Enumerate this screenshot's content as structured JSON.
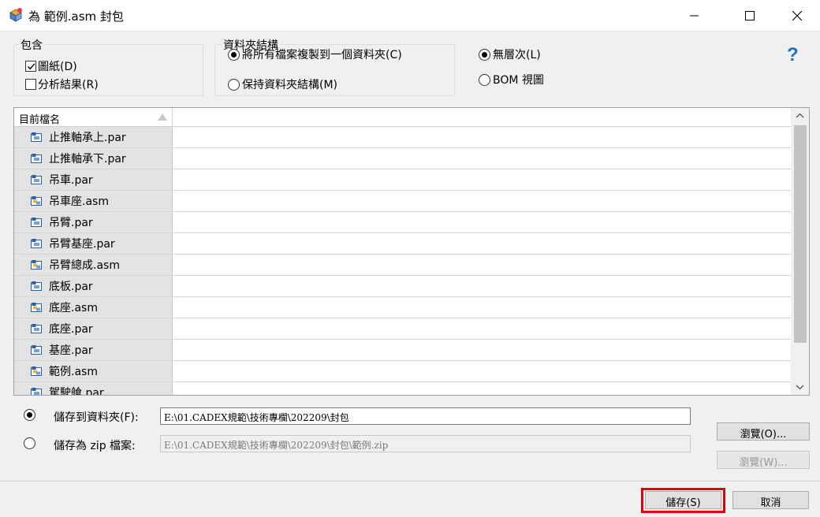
{
  "window": {
    "title": "為 範例.asm 封包",
    "controls": [
      "minimize-icon",
      "maximize-icon",
      "close-icon"
    ]
  },
  "include_group": {
    "legend": "包含",
    "drawings": {
      "label": "圖紙(D)",
      "checked": true
    },
    "analysis": {
      "label": "分析結果(R)",
      "checked": false
    }
  },
  "folder_group": {
    "legend": "資料夾結構",
    "copy_all": {
      "label": "將所有檔案複製到一個資料夾(C)",
      "selected": true
    },
    "keep_structure": {
      "label": "保持資料夾結構(M)",
      "selected": false
    }
  },
  "level_options": {
    "no_level": {
      "label": "無層次(L)",
      "selected": true
    },
    "bom_view": {
      "label": "BOM 視圖",
      "selected": false
    }
  },
  "file_table": {
    "header": "目前檔名",
    "rows": [
      {
        "name": "止推軸承上.par",
        "type": "part"
      },
      {
        "name": "止推軸承下.par",
        "type": "part"
      },
      {
        "name": "吊車.par",
        "type": "part"
      },
      {
        "name": "吊車座.asm",
        "type": "assembly"
      },
      {
        "name": "吊臂.par",
        "type": "part"
      },
      {
        "name": "吊臂基座.par",
        "type": "part"
      },
      {
        "name": "吊臂總成.asm",
        "type": "assembly"
      },
      {
        "name": "底板.par",
        "type": "part"
      },
      {
        "name": "底座.asm",
        "type": "assembly"
      },
      {
        "name": "底座.par",
        "type": "part"
      },
      {
        "name": "基座.par",
        "type": "part"
      },
      {
        "name": "範例.asm",
        "type": "assembly"
      },
      {
        "name": "駕駛艙.par",
        "type": "part"
      }
    ]
  },
  "save_to_folder": {
    "label": "儲存到資料夾(F):",
    "value": "E:\\01.CADEX規範\\技術專欄\\202209\\封包",
    "selected": true,
    "browse_label": "瀏覽(O)..."
  },
  "save_as_zip": {
    "label": "儲存為 zip 檔案:",
    "value": "E:\\01.CADEX規範\\技術專欄\\202209\\封包\\範例.zip",
    "selected": false,
    "browse_label": "瀏覽(W)..."
  },
  "footer": {
    "save_label": "儲存(S)",
    "cancel_label": "取消"
  },
  "colors": {
    "highlight": "#e00010",
    "help_icon": "#1a73c8"
  }
}
